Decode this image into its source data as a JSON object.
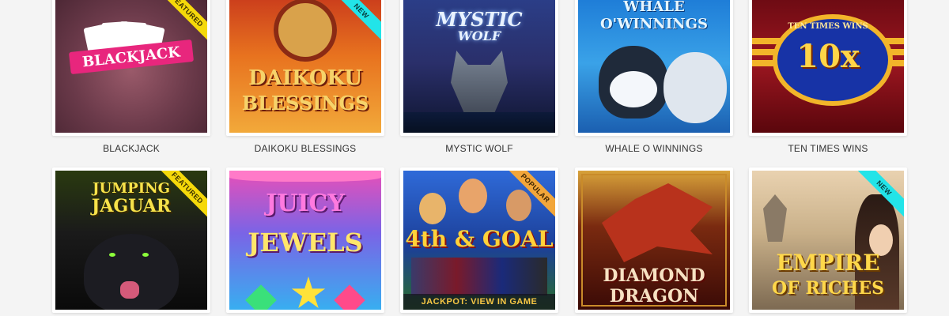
{
  "games": [
    {
      "title": "BLACKJACK",
      "art_text": "BLACKJACK",
      "badge": "FEATURED",
      "badge_type": "featured"
    },
    {
      "title": "DAIKOKU BLESSINGS",
      "art_text_1": "DAIKOKU",
      "art_text_2": "BLESSINGS",
      "badge": "NEW",
      "badge_type": "new"
    },
    {
      "title": "MYSTIC WOLF",
      "art_text_1": "MYSTIC",
      "art_text_2": "WOLF"
    },
    {
      "title": "WHALE O WINNINGS",
      "art_text_1": "WHALE",
      "art_text_2": "O'WINNINGS"
    },
    {
      "title": "TEN TIMES WINS",
      "art_text_1": "10x",
      "art_text_2": "TEN TIMES WINS"
    },
    {
      "art_text_1": "JUMPING",
      "art_text_2": "JAGUAR",
      "badge": "FEATURED",
      "badge_type": "featured"
    },
    {
      "art_text_1": "JUICY",
      "art_text_2": "JEWELS"
    },
    {
      "art_text_1": "4th & GOAL",
      "badge": "POPULAR",
      "badge_type": "popular",
      "jackpot": "JACKPOT: VIEW IN GAME"
    },
    {
      "art_text_1": "DIAMOND",
      "art_text_2": "DRAGON"
    },
    {
      "art_text_1": "EMPIRE",
      "art_text_2": "OF RICHES",
      "badge": "NEW",
      "badge_type": "new"
    }
  ],
  "colors": {
    "featured": "#f5d90a",
    "new": "#22e4e8",
    "popular": "#f2a63a",
    "page_bg": "#f4f4f4"
  }
}
